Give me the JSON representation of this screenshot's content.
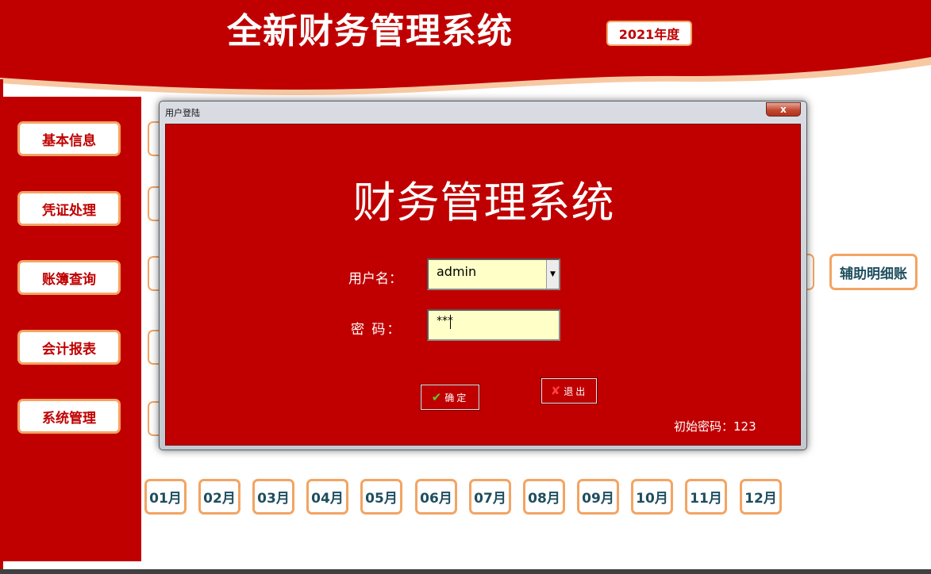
{
  "header": {
    "title": "全新财务管理系统",
    "year_badge": "2021年度"
  },
  "sidebar": {
    "items": [
      {
        "label": "基本信息"
      },
      {
        "label": "凭证处理"
      },
      {
        "label": "账簿查询"
      },
      {
        "label": "会计报表"
      },
      {
        "label": "系统管理"
      }
    ]
  },
  "aux_button": {
    "label": "辅助明细账"
  },
  "months": [
    "01月",
    "02月",
    "03月",
    "04月",
    "05月",
    "06月",
    "07月",
    "08月",
    "09月",
    "10月",
    "11月",
    "12月"
  ],
  "dialog": {
    "title": "用户登陆",
    "close_label": "x",
    "heading": "财务管理系统",
    "username_label": "用户名：",
    "username_value": "admin",
    "password_label": "密  码：",
    "password_value": "***",
    "ok_label": "确定",
    "exit_label": "退出",
    "hint": "初始密码：123"
  },
  "colors": {
    "brand_red": "#c00000",
    "accent_orange": "#f3a463",
    "month_text": "#1f4e5f",
    "input_bg": "#ffffc8"
  },
  "icons": {
    "ok": "check-icon",
    "exit": "x-icon",
    "combo": "dropdown-arrow-icon"
  }
}
